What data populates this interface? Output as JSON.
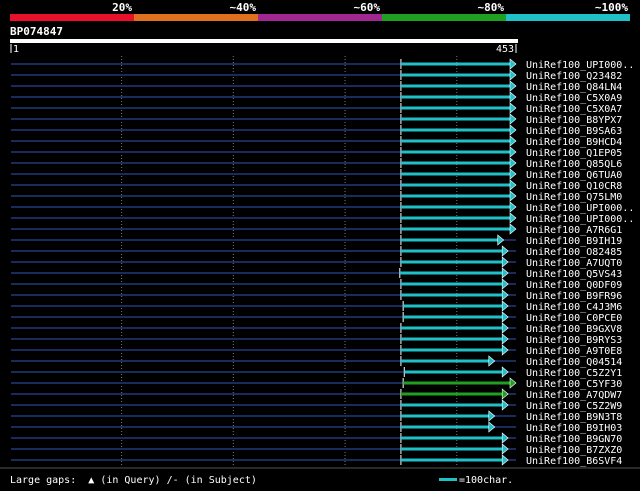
{
  "chart_data": {
    "type": "alignment",
    "query_id": "BP074847",
    "query_start": "1",
    "query_end": "453",
    "query_length": 453,
    "identity_scale": [
      {
        "label": "20%",
        "color": "#e8102a"
      },
      {
        "label": "~40%",
        "color": "#e07020"
      },
      {
        "label": "~60%",
        "color": "#a02890"
      },
      {
        "label": "~80%",
        "color": "#20a020"
      },
      {
        "label": "~100%",
        "color": "#20c0c8"
      }
    ],
    "hits": [
      {
        "name": "UniRef100_UPI000..",
        "start": 350,
        "end": 453,
        "color": "#20c0c8"
      },
      {
        "name": "UniRef100_Q23482",
        "start": 350,
        "end": 453,
        "color": "#20c0c8"
      },
      {
        "name": "UniRef100_Q84LN4",
        "start": 350,
        "end": 453,
        "color": "#20c0c8"
      },
      {
        "name": "UniRef100_C5X0A9",
        "start": 350,
        "end": 453,
        "color": "#20c0c8"
      },
      {
        "name": "UniRef100_C5X0A7",
        "start": 350,
        "end": 453,
        "color": "#20c0c8"
      },
      {
        "name": "UniRef100_B8YPX7",
        "start": 350,
        "end": 453,
        "color": "#20c0c8"
      },
      {
        "name": "UniRef100_B9SA63",
        "start": 350,
        "end": 453,
        "color": "#20c0c8"
      },
      {
        "name": "UniRef100_B9HCD4",
        "start": 350,
        "end": 453,
        "color": "#20c0c8"
      },
      {
        "name": "UniRef100_Q1EP05",
        "start": 350,
        "end": 453,
        "color": "#20c0c8"
      },
      {
        "name": "UniRef100_Q85QL6",
        "start": 350,
        "end": 453,
        "color": "#20c0c8"
      },
      {
        "name": "UniRef100_Q6TUA0",
        "start": 350,
        "end": 453,
        "color": "#20c0c8"
      },
      {
        "name": "UniRef100_Q10CR8",
        "start": 350,
        "end": 453,
        "color": "#20c0c8"
      },
      {
        "name": "UniRef100_Q75LM0",
        "start": 350,
        "end": 453,
        "color": "#20c0c8"
      },
      {
        "name": "UniRef100_UPI000..",
        "start": 350,
        "end": 453,
        "color": "#20c0c8"
      },
      {
        "name": "UniRef100_UPI000..",
        "start": 350,
        "end": 453,
        "color": "#20c0c8"
      },
      {
        "name": "UniRef100_A7R6G1",
        "start": 350,
        "end": 453,
        "color": "#20c0c8"
      },
      {
        "name": "UniRef100_B9IH19",
        "start": 350,
        "end": 442,
        "color": "#20c0c8"
      },
      {
        "name": "UniRef100_O82485",
        "start": 350,
        "end": 446,
        "color": "#20c0c8"
      },
      {
        "name": "UniRef100_A7UQT0",
        "start": 350,
        "end": 446,
        "color": "#20c0c8"
      },
      {
        "name": "UniRef100_Q5VS43",
        "start": 349,
        "end": 446,
        "color": "#20c0c8"
      },
      {
        "name": "UniRef100_Q0DF09",
        "start": 350,
        "end": 446,
        "color": "#20c0c8"
      },
      {
        "name": "UniRef100_B9FR96",
        "start": 350,
        "end": 446,
        "color": "#20c0c8"
      },
      {
        "name": "UniRef100_C4J3M6",
        "start": 352,
        "end": 446,
        "color": "#20c0c8"
      },
      {
        "name": "UniRef100_C0PCE0",
        "start": 352,
        "end": 446,
        "color": "#20c0c8"
      },
      {
        "name": "UniRef100_B9GXV8",
        "start": 350,
        "end": 446,
        "color": "#20c0c8"
      },
      {
        "name": "UniRef100_B9RYS3",
        "start": 350,
        "end": 446,
        "color": "#20c0c8"
      },
      {
        "name": "UniRef100_A9T0E8",
        "start": 350,
        "end": 446,
        "color": "#20c0c8"
      },
      {
        "name": "UniRef100_Q04514",
        "start": 350,
        "end": 434,
        "color": "#20c0c8"
      },
      {
        "name": "UniRef100_C5Z2Y1",
        "start": 353,
        "end": 446,
        "color": "#20c0c8"
      },
      {
        "name": "UniRef100_C5YF30",
        "start": 352,
        "end": 453,
        "color": "#20a020"
      },
      {
        "name": "UniRef100_A7QDW7",
        "start": 350,
        "end": 446,
        "color": "#20a020"
      },
      {
        "name": "UniRef100_C5Z2W9",
        "start": 350,
        "end": 446,
        "color": "#20c0c8"
      },
      {
        "name": "UniRef100_B9N3T8",
        "start": 350,
        "end": 434,
        "color": "#20c0c8"
      },
      {
        "name": "UniRef100_B9IH03",
        "start": 350,
        "end": 434,
        "color": "#20c0c8"
      },
      {
        "name": "UniRef100_B9GN70",
        "start": 350,
        "end": 446,
        "color": "#20c0c8"
      },
      {
        "name": "UniRef100_B7ZXZ0",
        "start": 350,
        "end": 446,
        "color": "#20c0c8"
      },
      {
        "name": "UniRef100_B6SVF4",
        "start": 350,
        "end": 446,
        "color": "#20c0c8"
      }
    ],
    "grid_ticks": [
      100,
      200,
      300,
      400
    ],
    "grid": true
  },
  "legend": {
    "gaps_prefix": "Large gaps:",
    "gaps_query_marker": "▲",
    "gaps_query_text": "(in Query)",
    "gaps_subject_text": "/- (in Subject)",
    "scale_text": "=100char."
  },
  "colors": {
    "background": "#000000",
    "text": "#ffffff",
    "query_line": "#1a2a5c",
    "grid": "#7a7a7a",
    "query_bar": "#ffffff"
  }
}
